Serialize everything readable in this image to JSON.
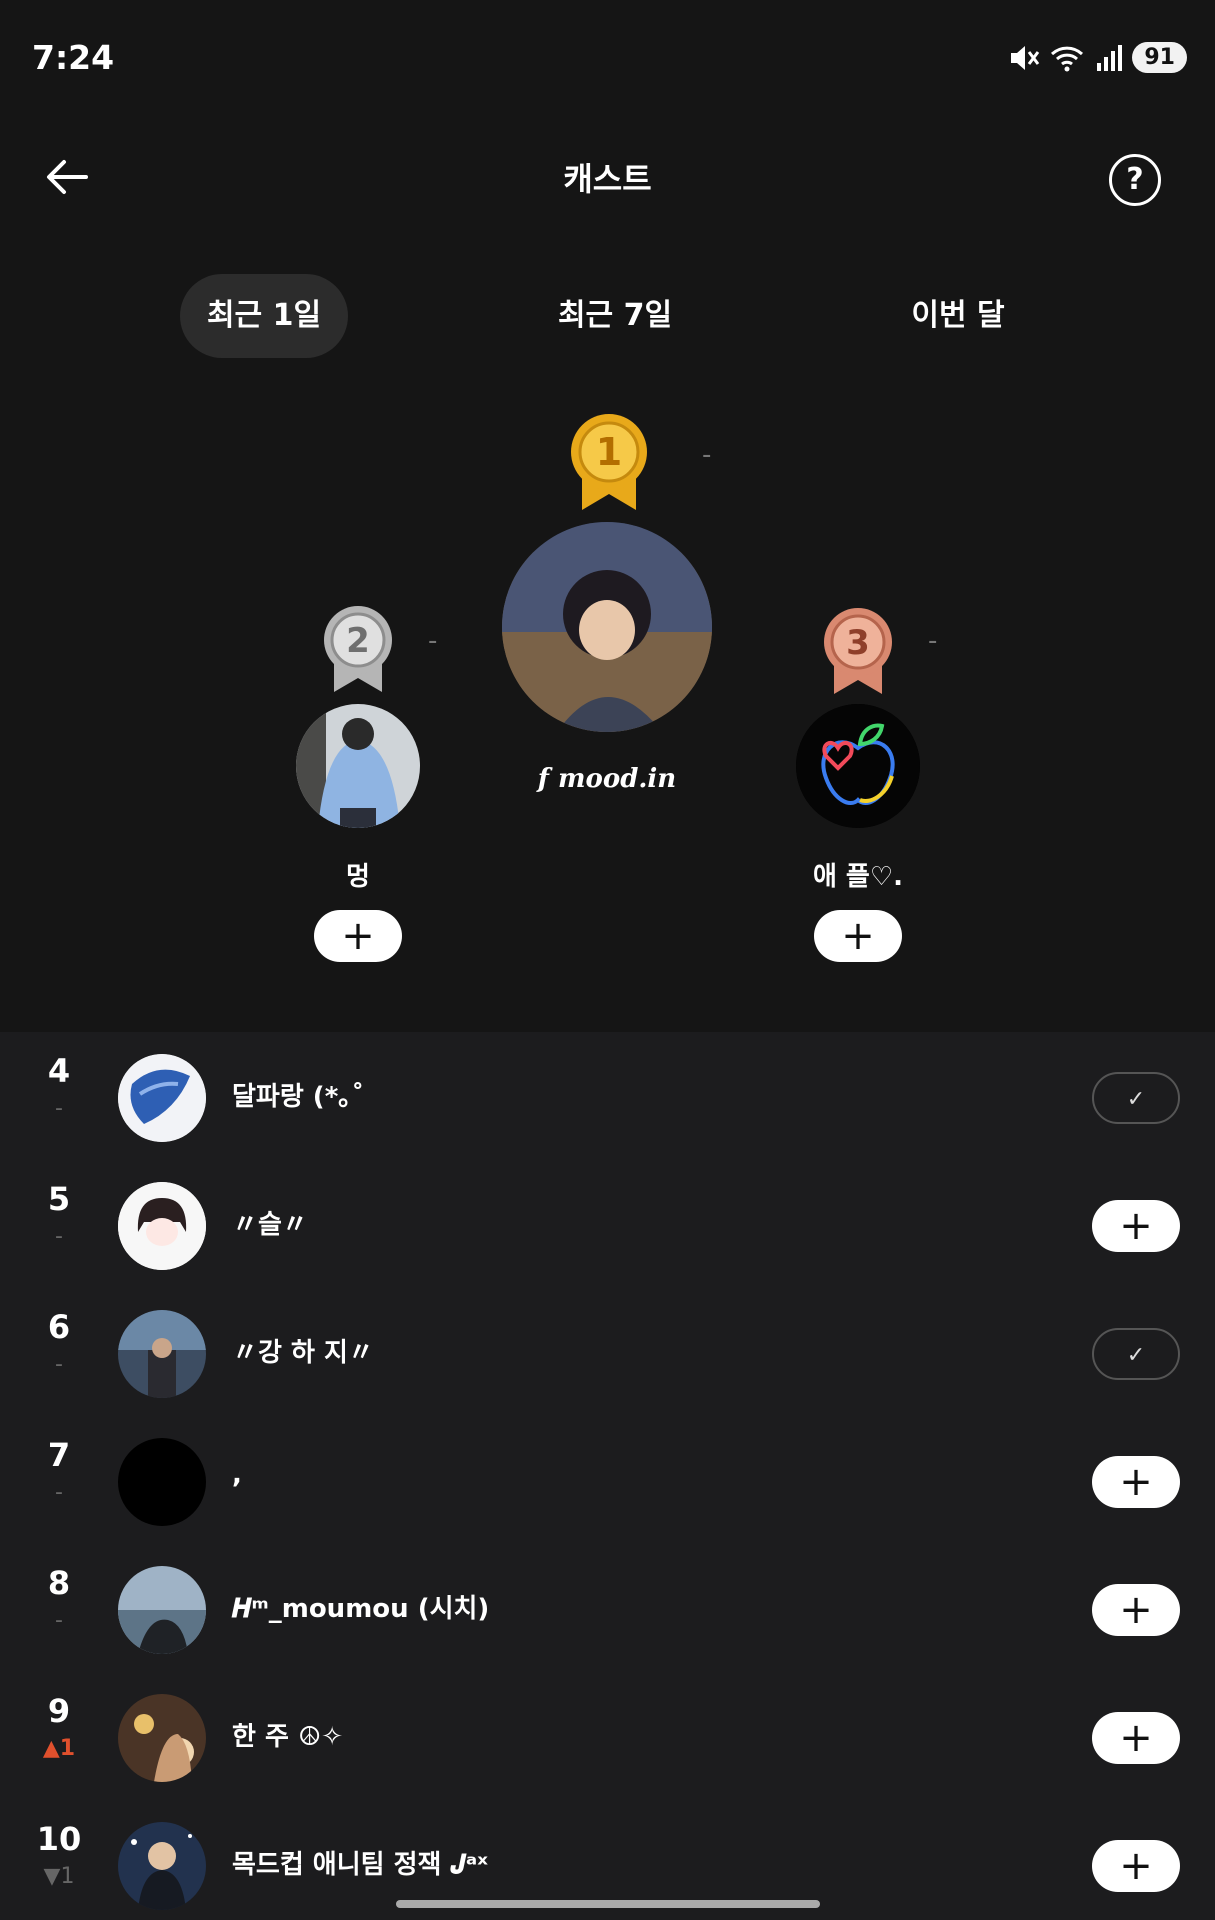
{
  "status": {
    "time": "7:24",
    "battery": "91"
  },
  "header": {
    "title": "캐스트",
    "help": "?"
  },
  "tabs": [
    {
      "label": "최근 1일",
      "active": true
    },
    {
      "label": "최근 7일",
      "active": false
    },
    {
      "label": "이번 달",
      "active": false
    }
  ],
  "podium": [
    {
      "rank": "1",
      "name": "",
      "change": "-",
      "following": false
    },
    {
      "rank": "2",
      "name": "멍",
      "change": "-",
      "following": false
    },
    {
      "rank": "3",
      "name": "애 플♡.",
      "change": "-",
      "following": false
    }
  ],
  "podium_avatar_caption": "f mood.in",
  "list": [
    {
      "rank": "4",
      "change": "-",
      "name": "달파랑 (*｡˚",
      "following": true
    },
    {
      "rank": "5",
      "change": "-",
      "name": "〃슬〃",
      "following": false
    },
    {
      "rank": "6",
      "change": "-",
      "name": "〃강 하 지〃",
      "following": true
    },
    {
      "rank": "7",
      "change": "-",
      "name": ",",
      "following": false
    },
    {
      "rank": "8",
      "change": "-",
      "name": "𝑯ᵐ_moumou (시치)",
      "following": false
    },
    {
      "rank": "9",
      "change": "▲1",
      "change_dir": "up",
      "name": "한 주 ☮✧",
      "following": false
    },
    {
      "rank": "10",
      "change": "▼1",
      "change_dir": "down",
      "name": "목드컵 애니팀 정잭 𝑱ᵃˣ",
      "following": false
    }
  ],
  "buttons": {
    "add": "+",
    "following": "✓"
  },
  "colors": {
    "background": "#151515",
    "list_background": "#1c1c1e",
    "gold": "#e8a91a",
    "silver": "#b5b5b5",
    "bronze": "#d98970",
    "rank_up": "#e0502d"
  }
}
